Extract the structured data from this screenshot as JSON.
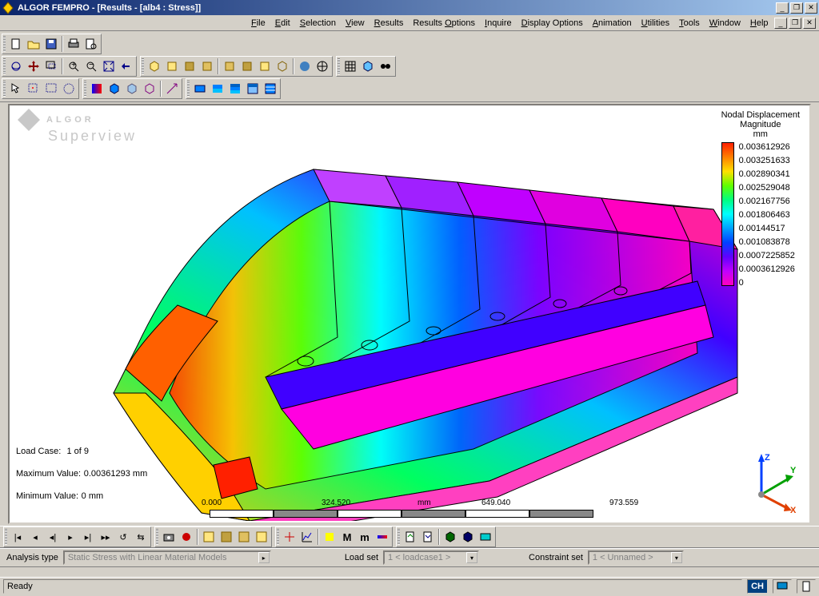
{
  "title": "ALGOR FEMPRO - [Results - [alb4 : Stress]]",
  "menu": [
    "File",
    "Edit",
    "Selection",
    "View",
    "Results",
    "Results Options",
    "Inquire",
    "Display Options",
    "Animation",
    "Utilities",
    "Tools",
    "Window",
    "Help"
  ],
  "watermark": {
    "brand": "ALGOR",
    "sub": "Superview"
  },
  "info": {
    "loadcase_label": "Load Case:",
    "loadcase_value": "1 of 9",
    "max_label": "Maximum Value:",
    "max_value": "0.00361293 mm",
    "min_label": "Minimum Value:",
    "min_value": "0 mm"
  },
  "legend": {
    "title1": "Nodal Displacement",
    "title2": "Magnitude",
    "unit": "mm",
    "ticks": [
      "0.003612926",
      "0.003251633",
      "0.002890341",
      "0.002529048",
      "0.002167756",
      "0.001806463",
      "0.00144517",
      "0.001083878",
      "0.0007225852",
      "0.0003612926",
      "0"
    ]
  },
  "scale": {
    "t0": "0.000",
    "t1": "324.520",
    "unit": "mm",
    "t2": "649.040",
    "t3": "973.559"
  },
  "triad": {
    "x": "X",
    "y": "Y",
    "z": "Z"
  },
  "options": {
    "analysis_label": "Analysis type",
    "analysis_value": "Static Stress with Linear Material Models",
    "loadset_label": "Load set",
    "loadset_value": "1 < loadcase1 >",
    "constraint_label": "Constraint set",
    "constraint_value": "1 < Unnamed >"
  },
  "status": {
    "ready": "Ready",
    "ch": "CH"
  }
}
